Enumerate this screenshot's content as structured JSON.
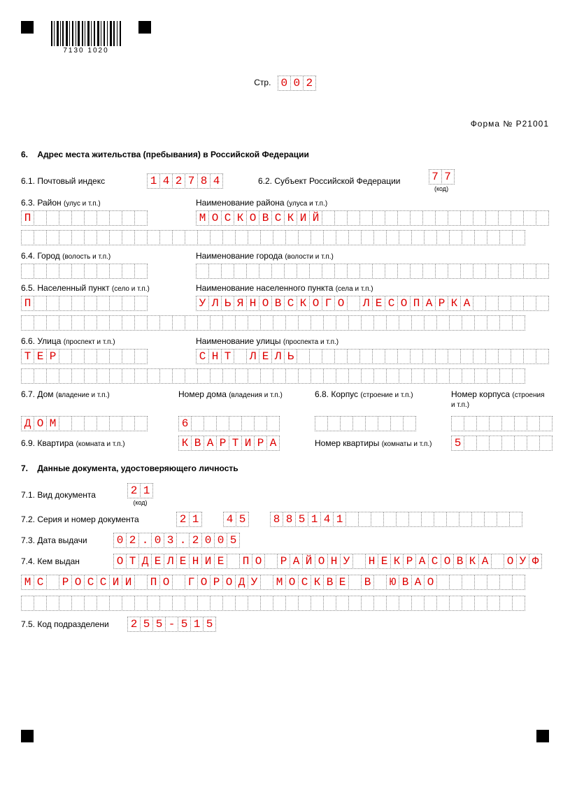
{
  "header": {
    "barcode_text": "7130 1020",
    "page_label": "Стр.",
    "page_number": "002",
    "form_label": "Форма № Р21001"
  },
  "section6": {
    "title_num": "6.",
    "title": "Адрес места жительства (пребывания) в Российской Федерации",
    "f61_label": "6.1. Почтовый индекс",
    "f61_value": "142784",
    "f62_label": "6.2. Субъект Российской Федерации",
    "f62_value": "77",
    "code_label": "(код)",
    "f63_label": "6.3. Район",
    "f63_sub": "(улус и т.п.)",
    "f63_name_label": "Наименование района",
    "f63_name_sub": "(улуса и т.п.)",
    "f63_type": "П",
    "f63_name": "МОСКОВСКИЙ",
    "f64_label": "6.4. Город",
    "f64_sub": "(волость и т.п.)",
    "f64_name_label": "Наименование города",
    "f64_name_sub": "(волости и т.п.)",
    "f64_type": "",
    "f64_name": "",
    "f65_label": "6.5. Населенный пункт",
    "f65_sub": "(село и т.п.)",
    "f65_name_label": "Наименование населенного пункта",
    "f65_name_sub": "(села и т.п.)",
    "f65_type": "П",
    "f65_name": "УЛЬЯНОВСКОГО ЛЕСОПАРКА",
    "f66_label": "6.6. Улица",
    "f66_sub": "(проспект и т.п.)",
    "f66_name_label": "Наименование улицы",
    "f66_name_sub": "(проспекта и т.п.)",
    "f66_type": "ТЕР",
    "f66_name": "СНТ ЛЕЛЬ",
    "f67_label": "6.7. Дом",
    "f67_sub": "(владение и т.п.)",
    "f67_num_label": "Номер дома",
    "f67_num_sub": "(владения и т.п.)",
    "f67_type": "ДОМ",
    "f67_num": "6",
    "f68_label": "6.8. Корпус",
    "f68_sub": "(строение и т.п.)",
    "f68_num_label": "Номер корпуса",
    "f68_num_sub": "(строения и т.п.)",
    "f68_type": "",
    "f68_num": "",
    "f69_label": "6.9. Квартира",
    "f69_sub": "(комната и т.п.)",
    "f69_type": "КВАРТИРА",
    "f69_num_label": "Номер квартиры",
    "f69_num_sub": "(комнаты и т.п.)",
    "f69_num": "5"
  },
  "section7": {
    "title_num": "7.",
    "title": "Данные документа, удостоверяющего личность",
    "f71_label": "7.1. Вид документа",
    "f71_value": "21",
    "code_label": "(код)",
    "f72_label": "7.2. Серия и номер документа",
    "f72_s1": "21",
    "f72_s2": "45",
    "f72_num": "885141",
    "f73_label": "7.3. Дата выдачи",
    "f73_value": "02.03.2005",
    "f74_label": "7.4. Кем выдан",
    "f74_line1": "ОТДЕЛЕНИЕ ПО РАЙОНУ НЕКРАСОВКА ОУФ",
    "f74_line2": "МС РОССИИ ПО ГОРОДУ МОСКВЕ В ЮВАО",
    "f74_line3": "",
    "f75_label": "7.5. Код подразделени",
    "f75_value": "255-515"
  }
}
